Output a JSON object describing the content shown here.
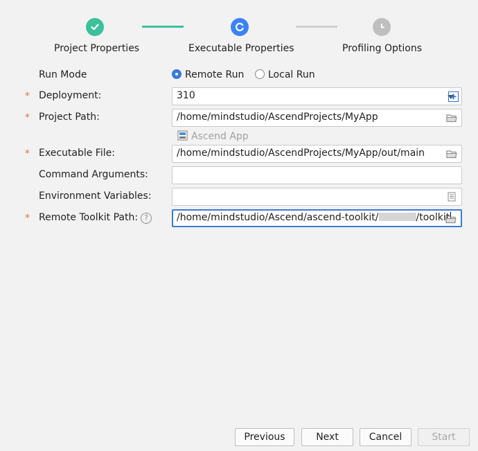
{
  "stepper": {
    "steps": [
      {
        "label": "Project Properties",
        "state": "done"
      },
      {
        "label": "Executable Properties",
        "state": "active"
      },
      {
        "label": "Profiling Options",
        "state": "pending"
      }
    ]
  },
  "colors": {
    "done": "#3cc19a",
    "active": "#3b82f6",
    "pending": "#bfbfbf",
    "required": "#e0762f",
    "focus": "#3a7bd5"
  },
  "form": {
    "run_mode": {
      "label": "Run Mode",
      "options": [
        "Remote Run",
        "Local Run"
      ],
      "selected": "Remote Run"
    },
    "deployment": {
      "required": "*",
      "label": "Deployment:",
      "value": "310"
    },
    "project_path": {
      "required": "*",
      "label": "Project Path:",
      "value": "/home/mindstudio/AscendProjects/MyApp"
    },
    "ascend_app": {
      "label": "Ascend App",
      "icon": "ascend-app-icon"
    },
    "executable_file": {
      "required": "*",
      "label": "Executable File:",
      "value": "/home/mindstudio/AscendProjects/MyApp/out/main"
    },
    "command_arguments": {
      "label": "Command Arguments:",
      "value": ""
    },
    "environment_variables": {
      "label": "Environment Variables:",
      "value": ""
    },
    "remote_toolkit_path": {
      "required": "*",
      "label": "Remote Toolkit Path:",
      "value_prefix": "/home/mindstudio/Ascend/ascend-toolkit/",
      "value_suffix": "/toolkit"
    }
  },
  "buttons": {
    "previous": "Previous",
    "next": "Next",
    "cancel": "Cancel",
    "start": "Start"
  }
}
